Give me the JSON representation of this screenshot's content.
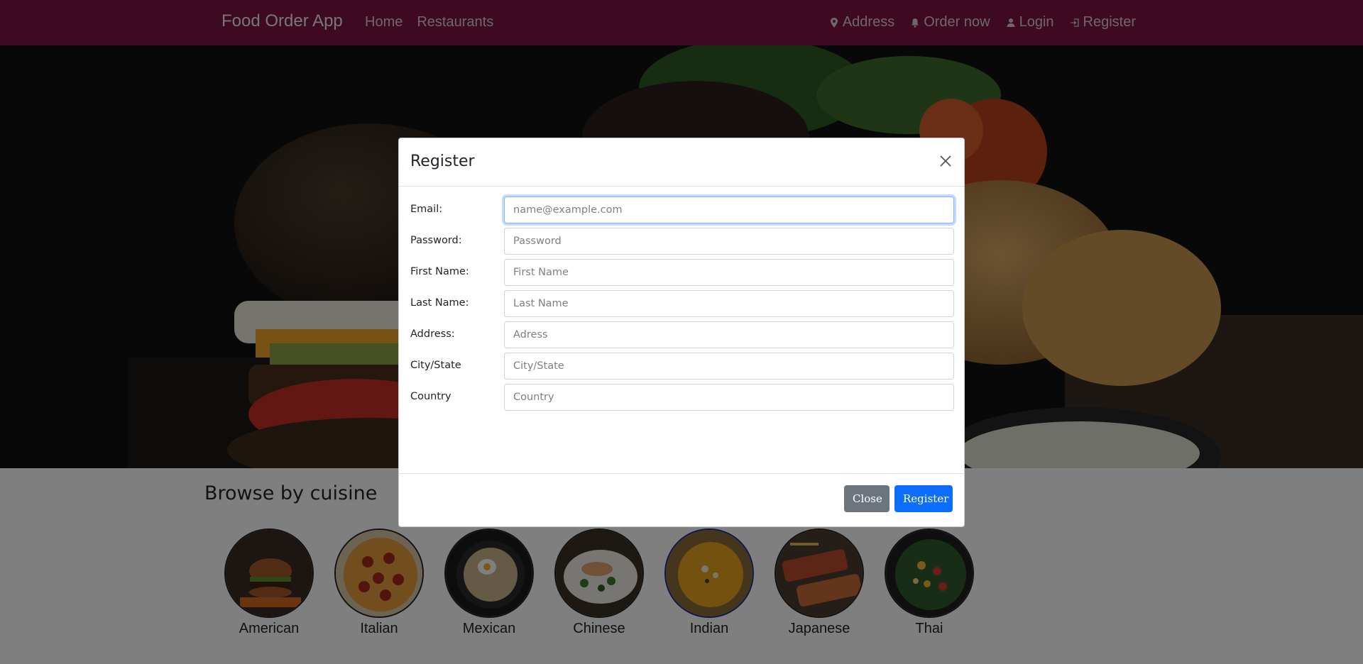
{
  "navbar": {
    "brand": "Food Order App",
    "left_links": [
      {
        "label": "Home"
      },
      {
        "label": "Restaurants"
      }
    ],
    "right_links": [
      {
        "label": "Address",
        "icon": "map-pin-icon"
      },
      {
        "label": "Order now",
        "icon": "bell-icon"
      },
      {
        "label": "Login",
        "icon": "user-icon"
      },
      {
        "label": "Register",
        "icon": "sign-in-icon"
      }
    ],
    "background": "#7a1543"
  },
  "cuisine": {
    "title": "Browse by cuisine",
    "items": [
      {
        "label": "American",
        "selected": false
      },
      {
        "label": "Italian",
        "selected": false
      },
      {
        "label": "Mexican",
        "selected": false
      },
      {
        "label": "Chinese",
        "selected": false
      },
      {
        "label": "Indian",
        "selected": true
      },
      {
        "label": "Japanese",
        "selected": false
      },
      {
        "label": "Thai",
        "selected": false
      }
    ]
  },
  "modal": {
    "title": "Register",
    "fields": [
      {
        "label": "Email:",
        "placeholder": "name@example.com",
        "value": "",
        "focused": true
      },
      {
        "label": "Password:",
        "placeholder": "Password",
        "value": ""
      },
      {
        "label": "First Name:",
        "placeholder": "First Name",
        "value": ""
      },
      {
        "label": "Last Name:",
        "placeholder": "Last Name",
        "value": ""
      },
      {
        "label": "Address:",
        "placeholder": "Adress",
        "value": ""
      },
      {
        "label": "City/State",
        "placeholder": "City/State",
        "value": ""
      },
      {
        "label": "Country",
        "placeholder": "Country",
        "value": ""
      }
    ],
    "close_label": "Close",
    "register_label": "Register",
    "colors": {
      "primary": "#0d6efd",
      "secondary": "#6c757d"
    }
  }
}
